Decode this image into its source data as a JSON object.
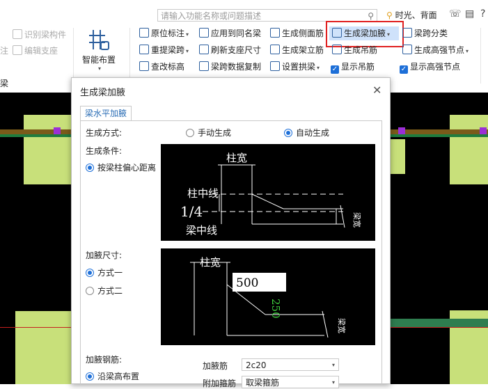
{
  "search": {
    "placeholder": "请输入功能名称或问题描述"
  },
  "user": {
    "name": "时光、背面"
  },
  "ribbon": {
    "left_col": [
      {
        "label": "识别梁构件"
      },
      {
        "label": "编辑支座"
      }
    ],
    "left_fragments": [
      "注",
      "梁"
    ],
    "smart_layout": "智能布置",
    "col1": [
      "原位标注",
      "重提梁跨",
      "查改标高"
    ],
    "col2": [
      "应用到同名梁",
      "刷新支座尺寸",
      "梁跨数据复制"
    ],
    "col3": [
      "生成侧面筋",
      "生成架立筋",
      "设置拱梁"
    ],
    "col4": [
      "生成梁加腋",
      "生成吊筋",
      "显示吊筋"
    ],
    "col5": [
      "梁跨分类",
      "生成高强节点",
      "显示高强节点"
    ]
  },
  "dialog": {
    "title": "生成梁加腋",
    "tab": "梁水平加腋",
    "gen_method_label": "生成方式:",
    "manual": "手动生成",
    "auto": "自动生成",
    "gen_cond_label": "生成条件:",
    "cond_option": "按梁柱偏心距离",
    "size_label": "加腋尺寸:",
    "mode1": "方式一",
    "mode2": "方式二",
    "rebar_label": "加腋钢筋:",
    "along_beam": "沿梁高布置",
    "rebar_field_label": "加腋筋",
    "rebar_value": "2c20",
    "stirrup_label": "附加箍筋",
    "stirrup_value": "取梁箍筋",
    "diagram1": {
      "col_width": "柱宽",
      "col_center": "柱中线",
      "ratio": "1/4",
      "beam_center": "梁中线",
      "side_mark": "梁宽"
    },
    "diagram2": {
      "col_width": "柱宽",
      "value": "500",
      "green_value": "250",
      "side_mark": "梁宽"
    }
  }
}
